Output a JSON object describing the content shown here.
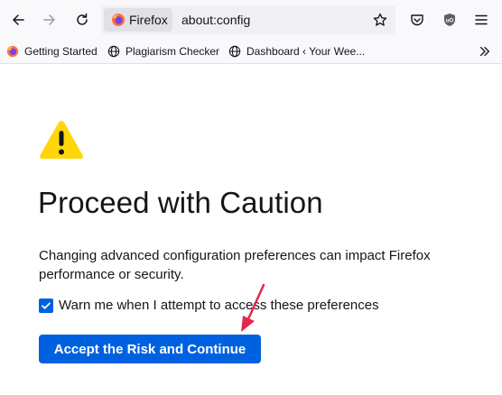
{
  "toolbar": {
    "identity_label": "Firefox",
    "url": "about:config"
  },
  "bookmarks": {
    "items": [
      {
        "label": "Getting Started",
        "icon": "firefox-icon"
      },
      {
        "label": "Plagiarism Checker",
        "icon": "globe-icon"
      },
      {
        "label": "Dashboard ‹ Your Wee...",
        "icon": "globe-icon"
      }
    ]
  },
  "content": {
    "title": "Proceed with Caution",
    "description": "Changing advanced configuration preferences can impact Firefox performance or security.",
    "checkbox_label": "Warn me when I attempt to access these preferences",
    "checkbox_checked": true,
    "button_label": "Accept the Risk and Continue"
  },
  "colors": {
    "accent": "#0061e0",
    "warning": "#ffd60a",
    "annotation_arrow": "#e22850"
  }
}
